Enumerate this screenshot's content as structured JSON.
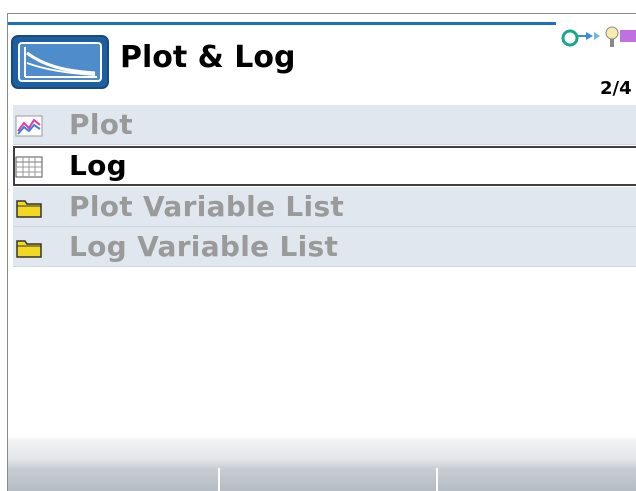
{
  "header": {
    "title": "Plot & Log",
    "page_indicator": "2/4",
    "app_icon": "plot-log-app-icon",
    "status_icons": [
      "connection-icon",
      "bluetooth-icon"
    ]
  },
  "menu": {
    "items": [
      {
        "label": "Plot",
        "icon": "plot-chart-icon",
        "selected": false
      },
      {
        "label": "Log",
        "icon": "log-table-icon",
        "selected": true
      },
      {
        "label": "Plot Variable List",
        "icon": "folder-icon",
        "selected": false
      },
      {
        "label": "Log Variable List",
        "icon": "folder-icon",
        "selected": false
      }
    ]
  },
  "softkeys": [
    "",
    "",
    ""
  ],
  "colors": {
    "accent": "#1f6fc0",
    "row_background": "#e1e7ef",
    "disabled_text": "#9a9a9a",
    "folder": "#f2d820"
  }
}
